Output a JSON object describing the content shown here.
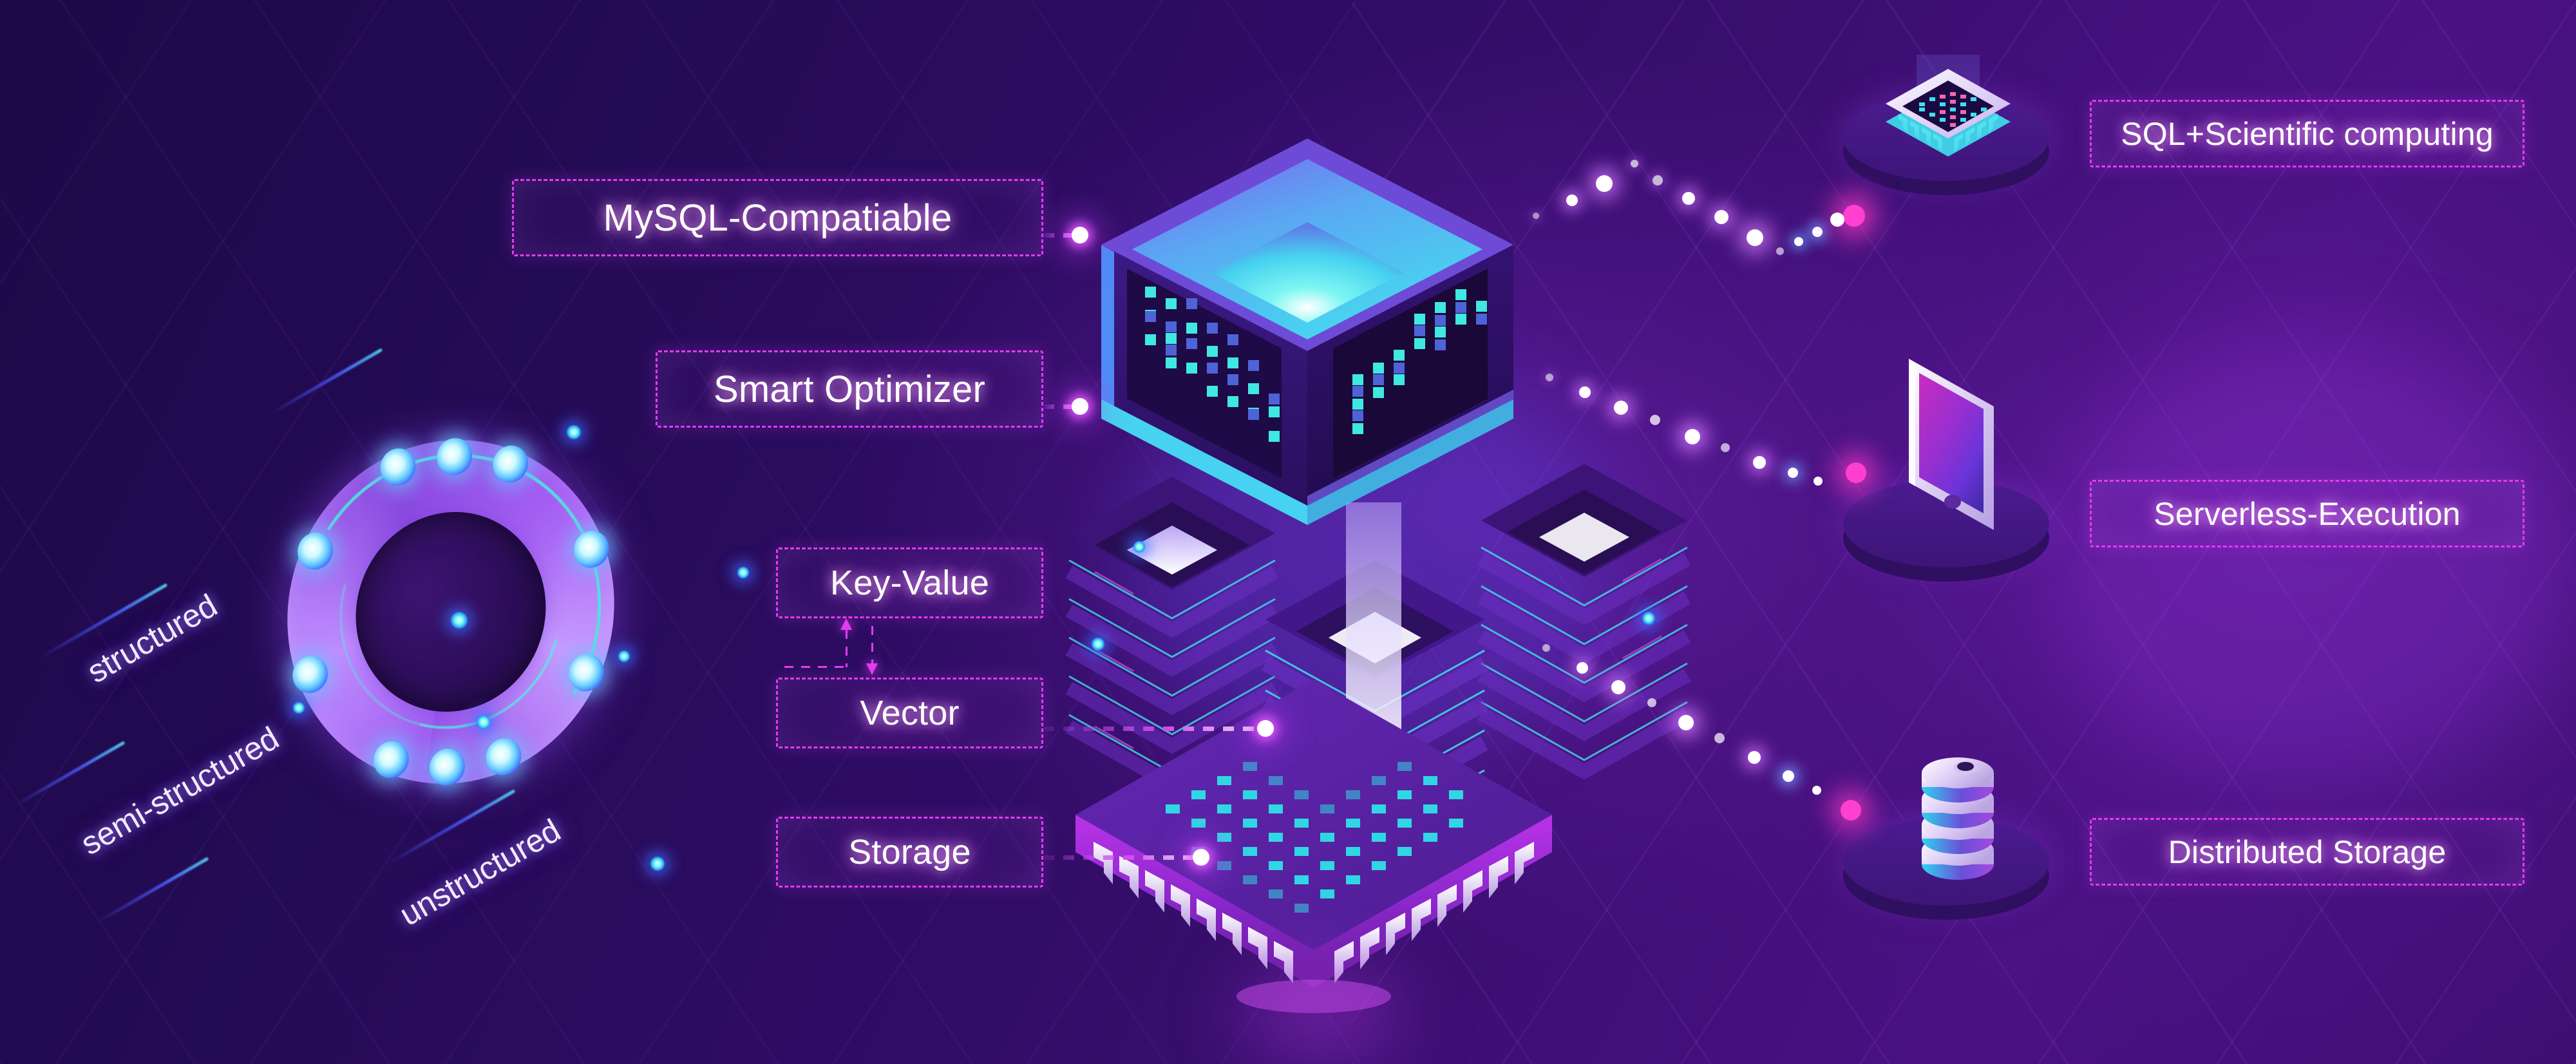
{
  "diagram": {
    "title": "Isometric cloud database architecture infographic",
    "background_color": "#2b0c5c",
    "accent_color": "#e23bf0",
    "glow_color": "#4ae8dd"
  },
  "left_labels": [
    {
      "id": "mysql",
      "text": "MySQL-Compatiable",
      "name": "label-mysql-compatiable"
    },
    {
      "id": "optimizer",
      "text": "Smart Optimizer",
      "name": "label-smart-optimizer"
    },
    {
      "id": "keyvalue",
      "text": "Key-Value",
      "name": "label-key-value"
    },
    {
      "id": "vector",
      "text": "Vector",
      "name": "label-vector"
    },
    {
      "id": "storage",
      "text": "Storage",
      "name": "label-storage"
    }
  ],
  "right_labels": [
    {
      "id": "sql",
      "text": "SQL+Scientific computing",
      "name": "label-sql-scientific-computing",
      "icon": "cpu-chip-icon"
    },
    {
      "id": "serverless",
      "text": "Serverless-Execution",
      "name": "label-serverless-execution",
      "icon": "smartphone-icon"
    },
    {
      "id": "distributed",
      "text": "Distributed Storage",
      "name": "label-distributed-storage",
      "icon": "database-stack-icon"
    }
  ],
  "data_types": [
    {
      "id": "structured",
      "text": "structured"
    },
    {
      "id": "semi_structured",
      "text": "semi-structured"
    },
    {
      "id": "unstructured",
      "text": "unstructured"
    }
  ],
  "icons": {
    "ring": "portal-ring-icon",
    "server_cube": "server-cube-icon",
    "cpu": "cpu-chip-icon",
    "phone": "smartphone-icon",
    "database": "database-stack-icon",
    "racks": "server-rack-icon"
  }
}
